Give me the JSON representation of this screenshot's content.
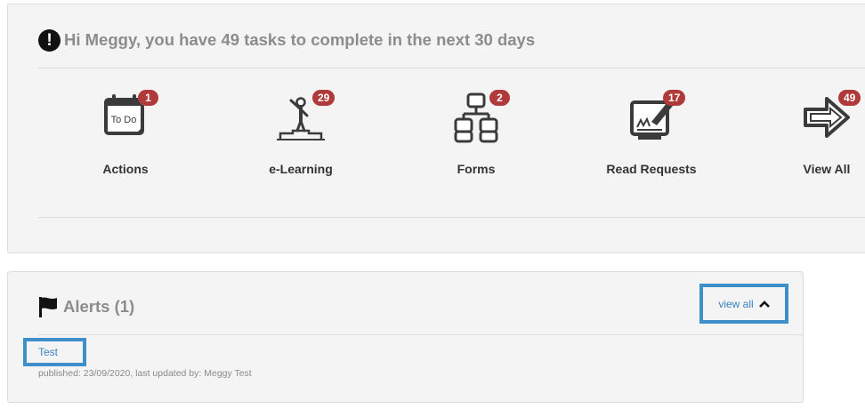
{
  "tasks": {
    "icon": "exclamation-circle-icon",
    "title": "Hi Meggy, you have 49 tasks to complete in the next 30 days",
    "tiles": [
      {
        "label": "Actions",
        "count": "1",
        "icon": "todo-calendar-icon",
        "icon_text": "To Do"
      },
      {
        "label": "e-Learning",
        "count": "29",
        "icon": "podium-person-icon"
      },
      {
        "label": "Forms",
        "count": "2",
        "icon": "form-hierarchy-icon"
      },
      {
        "label": "Read Requests",
        "count": "17",
        "icon": "signature-document-icon"
      },
      {
        "label": "View All",
        "count": "49",
        "icon": "arrow-right-icon"
      }
    ]
  },
  "alerts": {
    "icon": "flag-icon",
    "title": "Alerts (1)",
    "view_all_label": "view all",
    "view_all_icon": "chevron-up-icon",
    "items": [
      {
        "title": "Test",
        "meta": "published: 23/09/2020, last updated by: Meggy Test"
      }
    ]
  },
  "colors": {
    "panel_bg": "#f4f4f4",
    "badge": "#b0393a",
    "link": "#3a82c4",
    "highlight_border": "#3f8fcb",
    "heading_text": "#8c8c8c"
  }
}
